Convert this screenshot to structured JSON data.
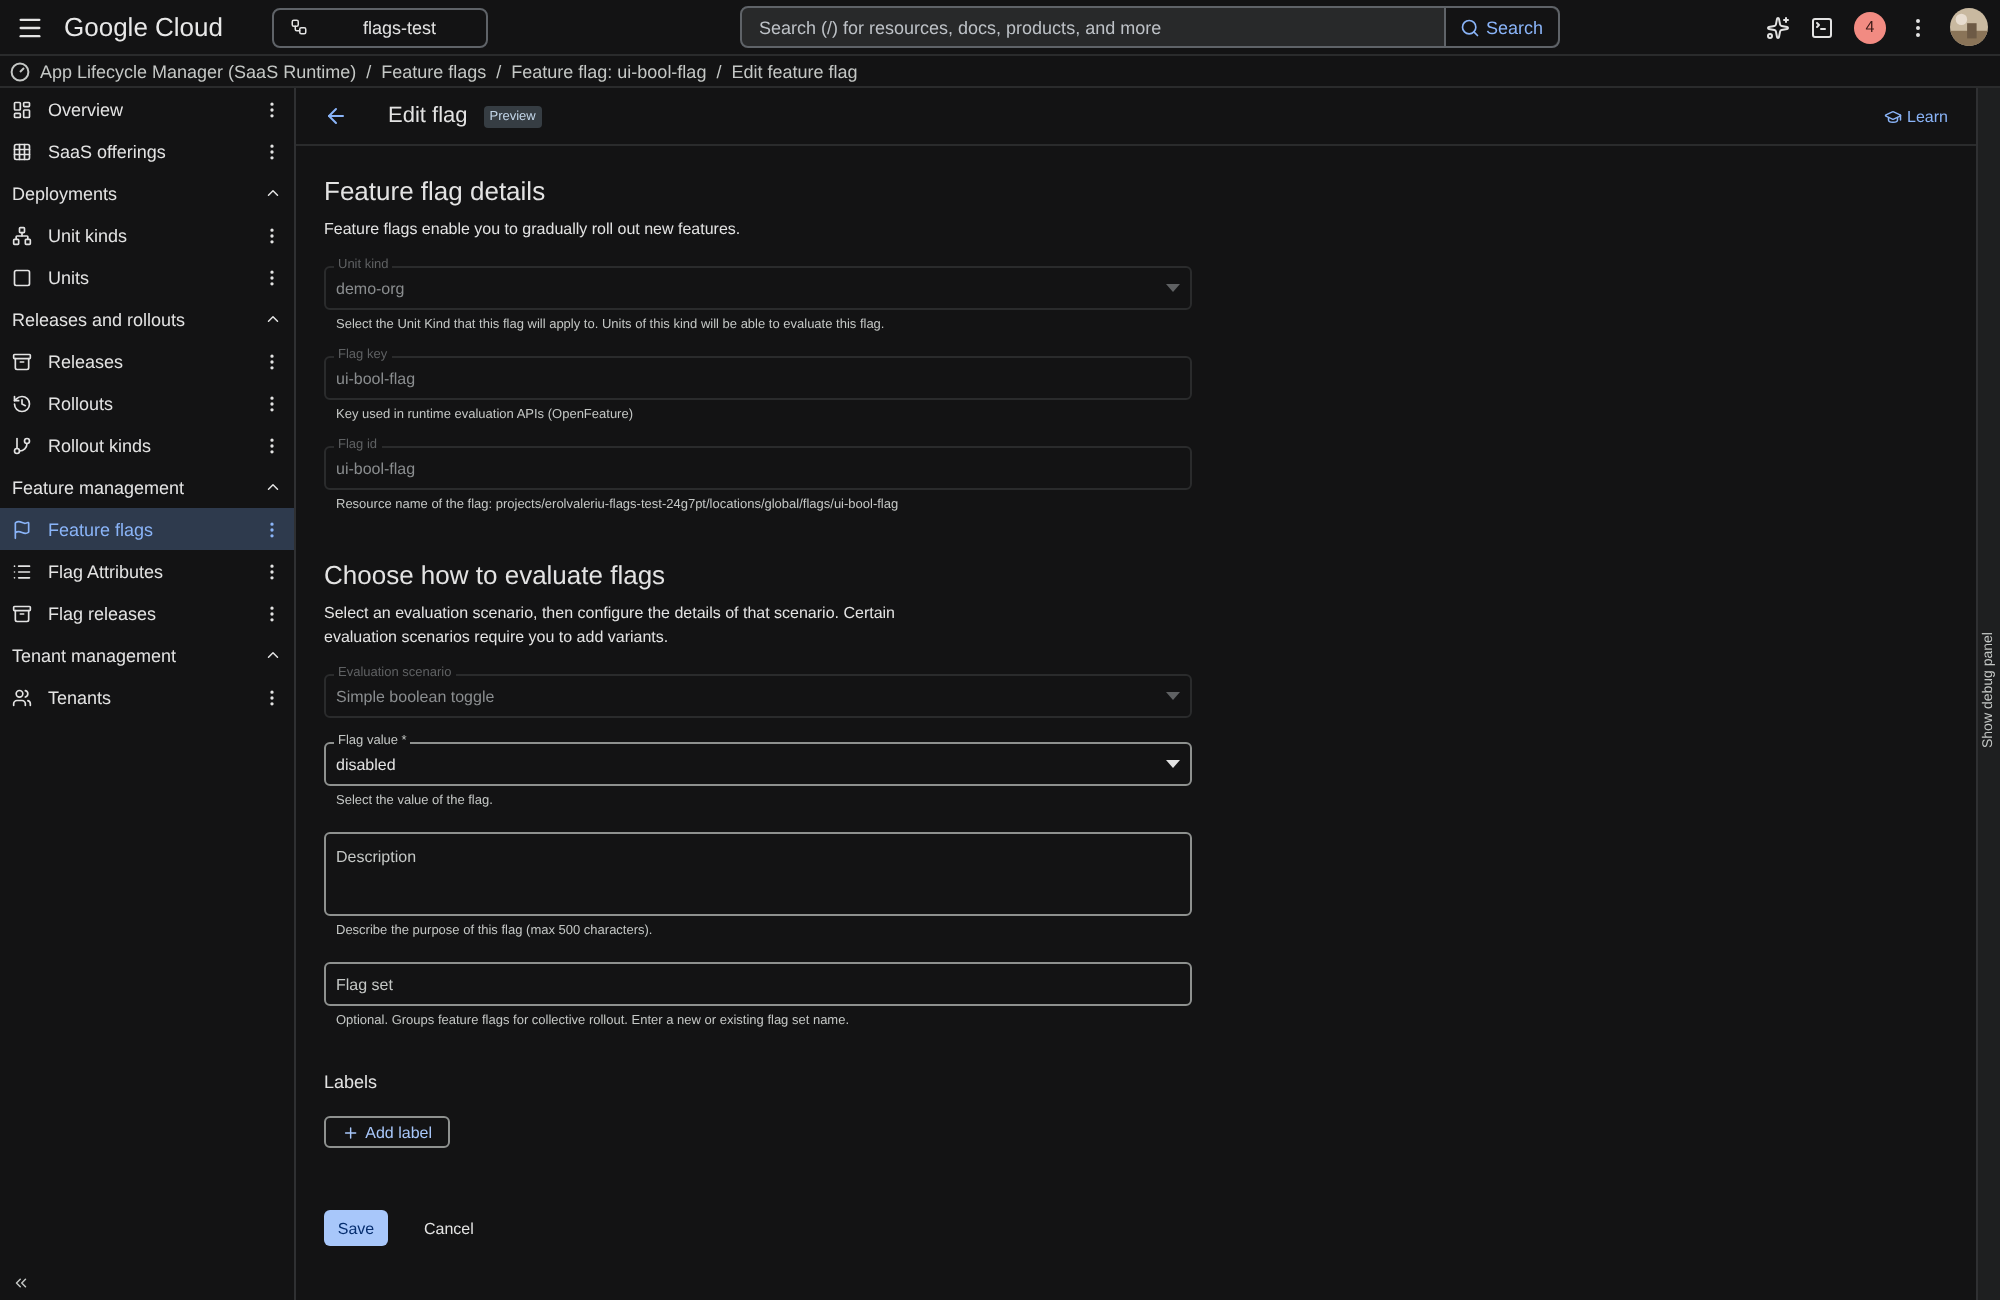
{
  "topbar": {
    "product": "Google Cloud",
    "project": "flags-test",
    "search": {
      "placeholder": "Search (/) for resources, docs, products, and more",
      "button": "Search"
    },
    "notifications": "4"
  },
  "breadcrumb": {
    "separator": "/",
    "items": [
      "App Lifecycle Manager (SaaS Runtime)",
      "Feature flags",
      "Feature flag: ui-bool-flag",
      "Edit feature flag"
    ]
  },
  "sidebar": {
    "sections": [
      {
        "items": [
          {
            "label": "Overview",
            "selected": false
          },
          {
            "label": "SaaS offerings",
            "selected": false
          }
        ]
      },
      {
        "title": "Deployments",
        "expanded": true,
        "items": [
          {
            "label": "Unit kinds",
            "selected": false
          },
          {
            "label": "Units",
            "selected": false
          }
        ]
      },
      {
        "title": "Releases and rollouts",
        "expanded": true,
        "items": [
          {
            "label": "Releases",
            "selected": false
          },
          {
            "label": "Rollouts",
            "selected": false
          },
          {
            "label": "Rollout kinds",
            "selected": false
          }
        ]
      },
      {
        "title": "Feature management",
        "expanded": true,
        "items": [
          {
            "label": "Feature flags",
            "selected": true
          },
          {
            "label": "Flag Attributes",
            "selected": false
          },
          {
            "label": "Flag releases",
            "selected": false
          }
        ]
      },
      {
        "title": "Tenant management",
        "expanded": true,
        "items": [
          {
            "label": "Tenants",
            "selected": false
          }
        ]
      }
    ]
  },
  "header": {
    "title": "Edit flag",
    "badge": "Preview",
    "learn": "Learn"
  },
  "sections": [
    {
      "title": "Feature flag details",
      "description": "Feature flags enable you to gradually roll out new features.",
      "fields": [
        {
          "kind": "select",
          "label": "Unit kind",
          "value": "demo-org",
          "disabled": true,
          "hint": "Select the Unit Kind that this flag will apply to. Units of this kind will be able to evaluate this flag."
        },
        {
          "kind": "text",
          "label": "Flag key",
          "value": "ui-bool-flag",
          "disabled": true,
          "hint": "Key used in runtime evaluation APIs (OpenFeature)"
        },
        {
          "kind": "text",
          "label": "Flag id",
          "value": "ui-bool-flag",
          "disabled": true,
          "hint": "Resource name of the flag: projects/erolvaleriu-flags-test-24g7pt/locations/global/flags/ui-bool-flag"
        }
      ]
    },
    {
      "title": "Choose how to evaluate flags",
      "description": "Select an evaluation scenario, then configure the details of that scenario. Certain evaluation scenarios require you to add variants.",
      "fields": [
        {
          "kind": "select",
          "label": "Evaluation scenario",
          "value": "Simple boolean toggle",
          "disabled": true
        },
        {
          "kind": "select",
          "label": "Flag value *",
          "value": "disabled",
          "disabled": false,
          "hint": "Select the value of the flag."
        },
        {
          "kind": "textarea",
          "label": "Description",
          "disabled": false,
          "hint": "Describe the purpose of this flag (max 500 characters)."
        },
        {
          "kind": "text",
          "label": "Flag set",
          "disabled": false,
          "hint": "Optional. Groups feature flags for collective rollout. Enter a new or existing flag set name."
        }
      ]
    }
  ],
  "labels": {
    "title": "Labels",
    "add": "Add label"
  },
  "actions": {
    "save": "Save",
    "cancel": "Cancel"
  },
  "debug_panel": "Show debug panel"
}
